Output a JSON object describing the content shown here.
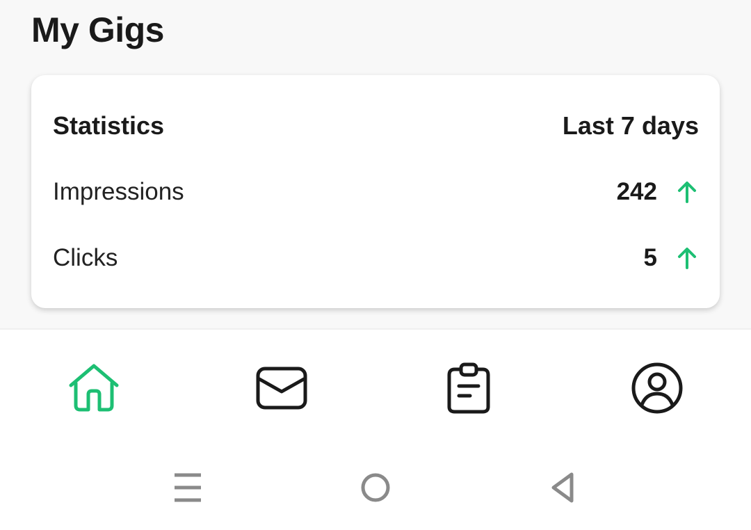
{
  "page": {
    "title": "My Gigs"
  },
  "statistics": {
    "title": "Statistics",
    "period": "Last 7 days",
    "rows": [
      {
        "label": "Impressions",
        "value": "242",
        "trend": "up"
      },
      {
        "label": "Clicks",
        "value": "5",
        "trend": "up"
      }
    ]
  },
  "bottom_nav": {
    "items": [
      {
        "name": "home",
        "icon": "home-icon",
        "active": true
      },
      {
        "name": "inbox",
        "icon": "envelope-icon",
        "active": false
      },
      {
        "name": "orders",
        "icon": "clipboard-icon",
        "active": false
      },
      {
        "name": "profile",
        "icon": "user-circle-icon",
        "active": false
      }
    ]
  },
  "system_nav": {
    "buttons": [
      "recent-apps-icon",
      "home-circle-icon",
      "back-triangle-icon"
    ]
  },
  "colors": {
    "accent": "#1dbf73",
    "icon": "#1a1a1a",
    "system_icon": "#8a8a8a",
    "background": "#f8f8f8"
  }
}
